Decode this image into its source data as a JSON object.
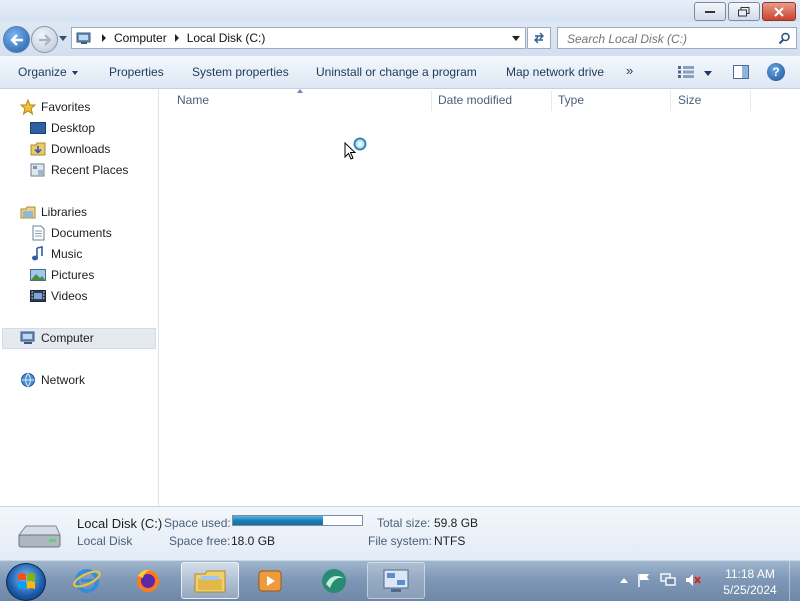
{
  "address": {
    "crumbs": [
      "Computer",
      "Local Disk (C:)"
    ]
  },
  "search": {
    "placeholder": "Search Local Disk (C:)"
  },
  "toolbar": {
    "organize": "Organize",
    "properties": "Properties",
    "system_properties": "System properties",
    "uninstall": "Uninstall or change a program",
    "map_drive": "Map network drive",
    "more": "»",
    "help": "?"
  },
  "nav": {
    "favorites": "Favorites",
    "desktop": "Desktop",
    "downloads": "Downloads",
    "recent_places": "Recent Places",
    "libraries": "Libraries",
    "documents": "Documents",
    "music": "Music",
    "pictures": "Pictures",
    "videos": "Videos",
    "computer": "Computer",
    "network": "Network"
  },
  "columns": {
    "name": "Name",
    "date_modified": "Date modified",
    "type": "Type",
    "size": "Size"
  },
  "details": {
    "drive_name": "Local Disk (C:)",
    "drive_type": "Local Disk",
    "space_used_label": "Space used:",
    "space_used_fraction": 0.7,
    "space_free_label": "Space free:",
    "space_free_value": "18.0 GB",
    "total_size_label": "Total size:",
    "total_size_value": "59.8 GB",
    "file_system_label": "File system:",
    "file_system_value": "NTFS"
  },
  "taskbar": {
    "apps": [
      "internet-explorer",
      "firefox",
      "windows-explorer",
      "media-player",
      "app-green",
      "control-panel"
    ],
    "active_app": "windows-explorer",
    "time": "11:18 AM",
    "date": "5/25/2024"
  }
}
